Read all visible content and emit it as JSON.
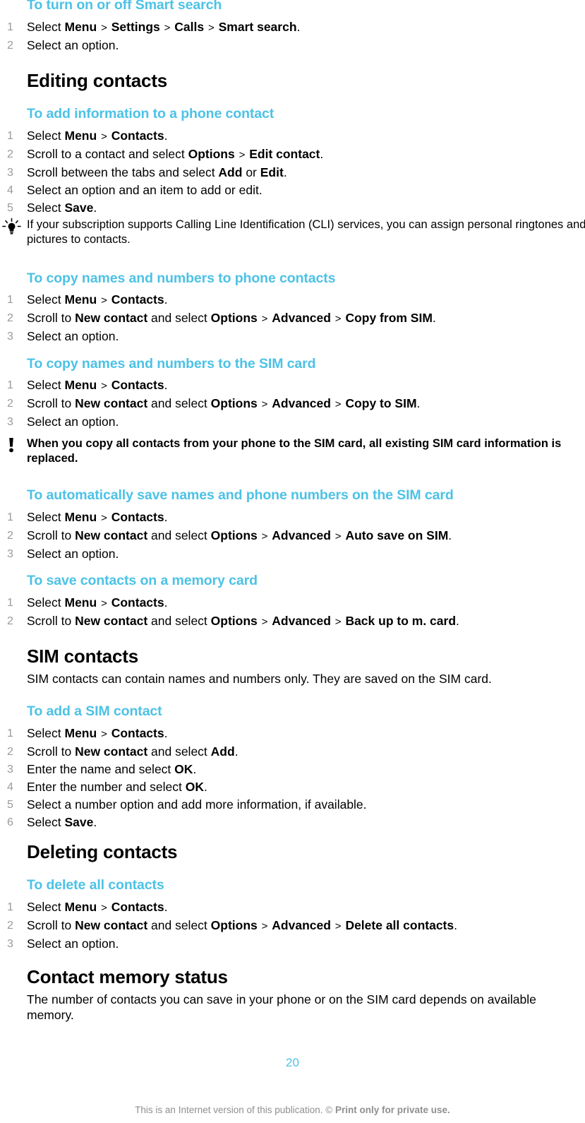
{
  "page": {
    "number": "20",
    "footer_prefix": "This is an Internet version of this publication. © ",
    "footer_bold": "Print only for private use."
  },
  "blocks": {
    "smart_search": {
      "title": "To turn on or off Smart search",
      "steps": [
        "Select <b>Menu</b> <span class=\"gt\">&gt;</span> <b>Settings</b> <span class=\"gt\">&gt;</span> <b>Calls</b> <span class=\"gt\">&gt;</span> <b>Smart search</b>.",
        "Select an option."
      ]
    },
    "editing_contacts": {
      "title": "Editing contacts"
    },
    "add_info_phone_contact": {
      "title": "To add information to a phone contact",
      "steps": [
        "Select <b>Menu</b> <span class=\"gt\">&gt;</span> <b>Contacts</b>.",
        "Scroll to a contact and select <b>Options</b> <span class=\"gt\">&gt;</span> <b>Edit contact</b>.",
        "Scroll between the tabs and select <b>Add</b> or <b>Edit</b>.",
        "Select an option and an item to add or edit.",
        "Select <b>Save</b>."
      ]
    },
    "tip_cli": {
      "icon": "lightbulb-icon",
      "text": "If your subscription supports Calling Line Identification (CLI) services, you can assign personal ringtones and pictures to contacts."
    },
    "copy_to_phone": {
      "title": "To copy names and numbers to phone contacts",
      "steps": [
        "Select <b>Menu</b> <span class=\"gt\">&gt;</span> <b>Contacts</b>.",
        "Scroll to <b>New contact</b> and select <b>Options</b> <span class=\"gt\">&gt;</span> <b>Advanced</b> <span class=\"gt\">&gt;</span> <b>Copy from SIM</b>.",
        "Select an option."
      ]
    },
    "copy_to_sim": {
      "title": "To copy names and numbers to the SIM card",
      "steps": [
        "Select <b>Menu</b> <span class=\"gt\">&gt;</span> <b>Contacts</b>.",
        "Scroll to <b>New contact</b> and select <b>Options</b> <span class=\"gt\">&gt;</span> <b>Advanced</b> <span class=\"gt\">&gt;</span> <b>Copy to SIM</b>.",
        "Select an option."
      ]
    },
    "note_replace": {
      "icon": "exclamation-icon",
      "text": "When you copy all contacts from your phone to the SIM card, all existing SIM card information is replaced."
    },
    "auto_save_sim": {
      "title": "To automatically save names and phone numbers on the SIM card",
      "steps": [
        "Select <b>Menu</b> <span class=\"gt\">&gt;</span> <b>Contacts</b>.",
        "Scroll to <b>New contact</b> and select <b>Options</b> <span class=\"gt\">&gt;</span> <b>Advanced</b> <span class=\"gt\">&gt;</span> <b>Auto save on SIM</b>.",
        "Select an option."
      ]
    },
    "save_memory_card": {
      "title": "To save contacts on a memory card",
      "steps": [
        "Select <b>Menu</b> <span class=\"gt\">&gt;</span> <b>Contacts</b>.",
        "Scroll to <b>New contact</b> and select <b>Options</b> <span class=\"gt\">&gt;</span> <b>Advanced</b> <span class=\"gt\">&gt;</span> <b>Back up to m. card</b>."
      ]
    },
    "sim_contacts": {
      "title": "SIM contacts",
      "intro": "SIM contacts can contain names and numbers only. They are saved on the SIM card."
    },
    "add_sim_contact": {
      "title": "To add a SIM contact",
      "steps": [
        "Select <b>Menu</b> <span class=\"gt\">&gt;</span> <b>Contacts</b>.",
        "Scroll to <b>New contact</b> and select <b>Add</b>.",
        "Enter the name and select <b>OK</b>.",
        "Enter the number and select <b>OK</b>.",
        "Select a number option and add more information, if available.",
        "Select <b>Save</b>."
      ]
    },
    "deleting_contacts": {
      "title": "Deleting contacts"
    },
    "delete_all": {
      "title": "To delete all contacts",
      "steps": [
        "Select <b>Menu</b> <span class=\"gt\">&gt;</span> <b>Contacts</b>.",
        "Scroll to <b>New contact</b> and select <b>Options</b> <span class=\"gt\">&gt;</span> <b>Advanced</b> <span class=\"gt\">&gt;</span> <b>Delete all contacts</b>.",
        "Select an option."
      ]
    },
    "memory_status": {
      "title": "Contact memory status",
      "intro": "The number of contacts you can save in your phone or on the SIM card depends on available memory."
    }
  },
  "colors": {
    "accent": "#4cc2e6",
    "text": "#000000",
    "step_number": "#9a9a9a",
    "footer": "#8f8f8f"
  }
}
